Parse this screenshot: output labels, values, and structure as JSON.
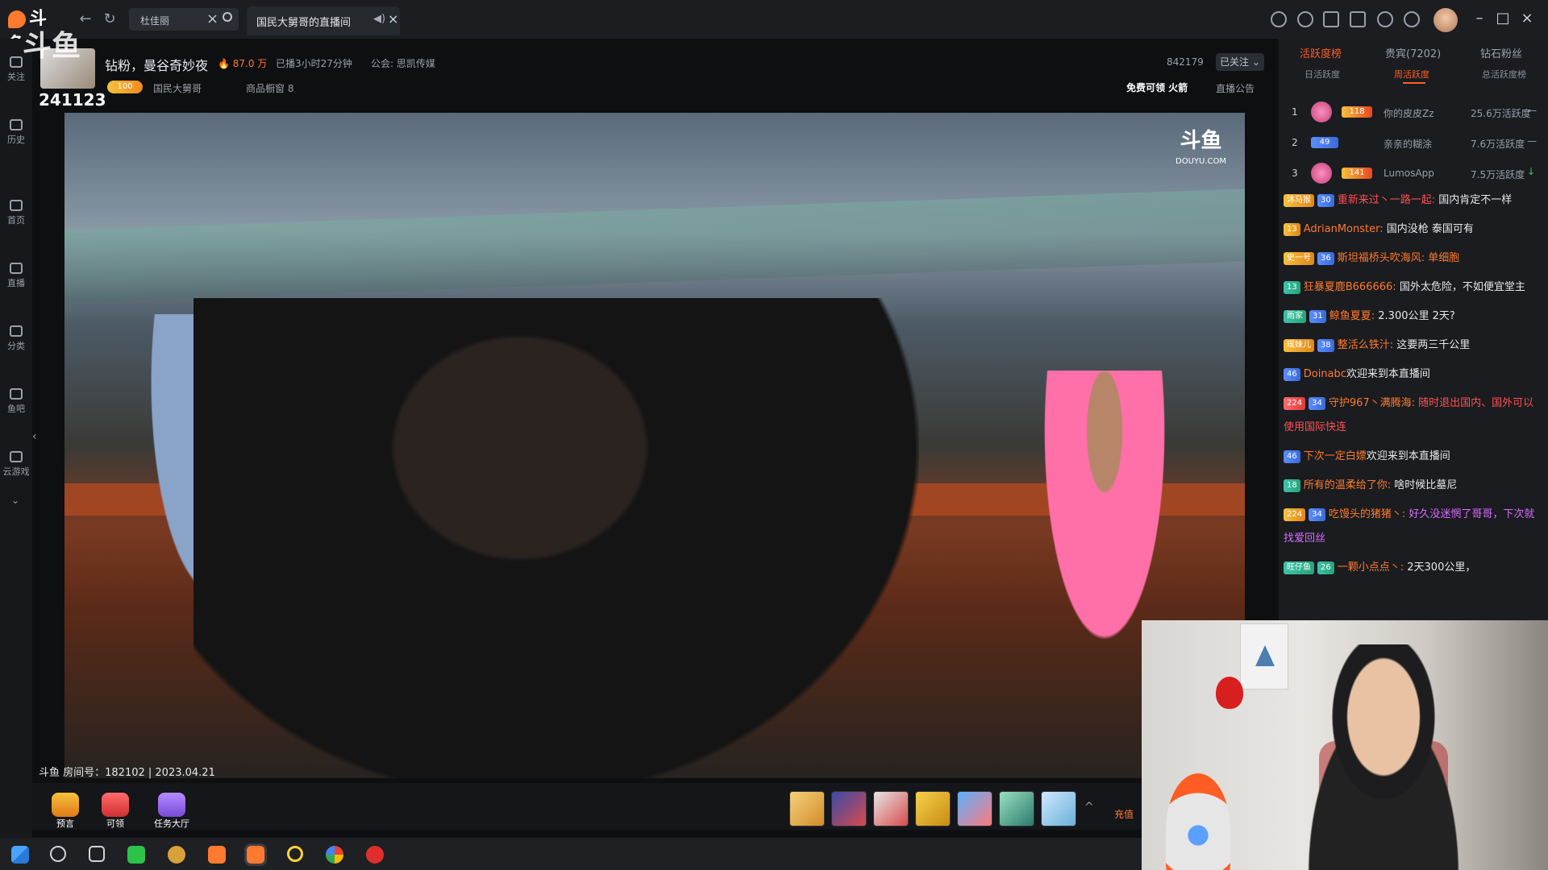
{
  "window": {
    "logo_text": "斗鱼",
    "search_value": "杜佳丽",
    "active_tab": "国民大舅哥的直播间"
  },
  "left_nav": [
    {
      "label": "关注"
    },
    {
      "label": "历史"
    },
    {
      "label": "首页"
    },
    {
      "label": "直播"
    },
    {
      "label": "分类"
    },
    {
      "label": "鱼吧"
    },
    {
      "label": "云游戏"
    }
  ],
  "stream": {
    "follow_count": "241123",
    "title": "钻粉，曼谷奇妙夜",
    "heat": "87.0 万",
    "duration": "已播3小时27分钟",
    "guild": "公会: 思凯传媒",
    "badge": "100",
    "anchor": "国民大舅哥",
    "shop": "商品橱窗 8",
    "room_number": "842179",
    "followed_label": "已关注",
    "free_rocket": "免费可领 火箭",
    "notice": "直播公告",
    "room_info": "斗鱼 房间号：182102 | 2023.04.21",
    "watermark": "斗鱼",
    "watermark_sub": "DOUYU.COM"
  },
  "bottom_bar": {
    "buttons": [
      {
        "label": "预言"
      },
      {
        "label": "可领"
      },
      {
        "label": "任务大厅"
      }
    ],
    "recharge": "充值"
  },
  "right_panel": {
    "tabs": [
      "活跃度榜",
      "贵宾(7202)",
      "钻石粉丝"
    ],
    "subtabs": [
      "日活跃度",
      "周活跃度",
      "总活跃度榜"
    ],
    "ranking": [
      {
        "rank": "1",
        "level": "118",
        "name": "你的皮皮Zz",
        "score": "25.6万活跃度",
        "trend": "—"
      },
      {
        "rank": "2",
        "level": "49",
        "name": "亲亲的糊涂",
        "score": "7.6万活跃度",
        "trend": "—"
      },
      {
        "rank": "3",
        "level": "141",
        "name": "LumosApp",
        "score": "7.5万活跃度",
        "trend": "↓"
      }
    ],
    "chat": [
      {
        "b1": "沐马猴",
        "b2": "30",
        "user": "重新来过丶一路一起:",
        "text": "国内肯定不一样",
        "c": ""
      },
      {
        "b1": "13",
        "b2": "",
        "user": "AdrianMonster:",
        "text": "国内没枪  泰国可有",
        "c": ""
      },
      {
        "b1": "史一号",
        "b2": "36",
        "user": "斯坦福桥头吹海风:",
        "text": "单细胞",
        "c": "orange"
      },
      {
        "b1": "13",
        "b2": "",
        "user": "狂暴夏鹿B666666:",
        "text": "国外太危险，不如便宜堂主",
        "c": ""
      },
      {
        "b1": "雨家",
        "b2": "31",
        "user": "鲸鱼夏夏:",
        "text": "2.300公里 2天?",
        "c": ""
      },
      {
        "b1": "瑶妹儿",
        "b2": "38",
        "user": "整活么铁汁:",
        "text": "这要两三千公里",
        "c": ""
      },
      {
        "b1": "46",
        "b2": "",
        "user": "Doinabc",
        "text": "欢迎来到本直播间",
        "c": ""
      },
      {
        "b1": "224",
        "b2": "34",
        "user": "守护967丶满腾海:",
        "text": "随时退出国内、国外可以使用国际快连",
        "c": "red"
      },
      {
        "b1": "46",
        "b2": "",
        "user": "下次一定白嫖",
        "text": "欢迎来到本直播间",
        "c": ""
      },
      {
        "b1": "18",
        "b2": "",
        "user": "所有的温柔给了你:",
        "text": "啥时候比墓尼",
        "c": ""
      },
      {
        "b1": "224",
        "b2": "34",
        "user": "吃馒头的猪猪丶:",
        "text": "好久没迷惘了哥哥，下次就找爱回丝",
        "c": "pink"
      },
      {
        "b1": "旺仔鱼",
        "b2": "26",
        "user": "一颗小点点丶:",
        "text": "2天300公里，",
        "c": ""
      }
    ]
  }
}
